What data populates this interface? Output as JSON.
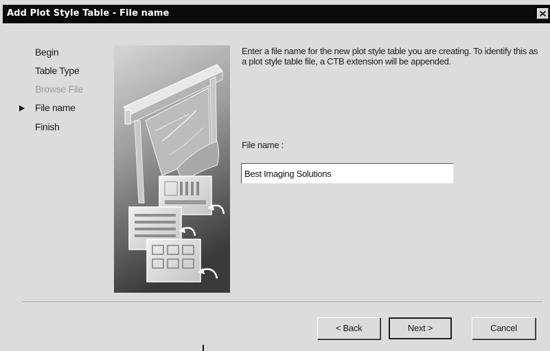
{
  "window": {
    "title": "Add Plot Style Table - File name"
  },
  "steps": [
    {
      "label": "Begin",
      "state": "normal"
    },
    {
      "label": "Table Type",
      "state": "normal"
    },
    {
      "label": "Browse File",
      "state": "disabled"
    },
    {
      "label": "File name",
      "state": "current"
    },
    {
      "label": "Finish",
      "state": "normal"
    }
  ],
  "content": {
    "intro_text": "Enter a file name for the new plot style table you are creating. To identify this as a plot style table file, a CTB extension will be appended.",
    "field_label": "File name :",
    "filename_value": "Best Imaging Solutions"
  },
  "buttons": {
    "back": "< Back",
    "next": "Next >",
    "cancel": "Cancel"
  },
  "icons": {
    "close": "close-icon",
    "current_step": "current-step-arrow-icon"
  },
  "colors": {
    "dialog_bg": "#dcdcdc",
    "titlebar_bg": "#0b0b0b"
  }
}
